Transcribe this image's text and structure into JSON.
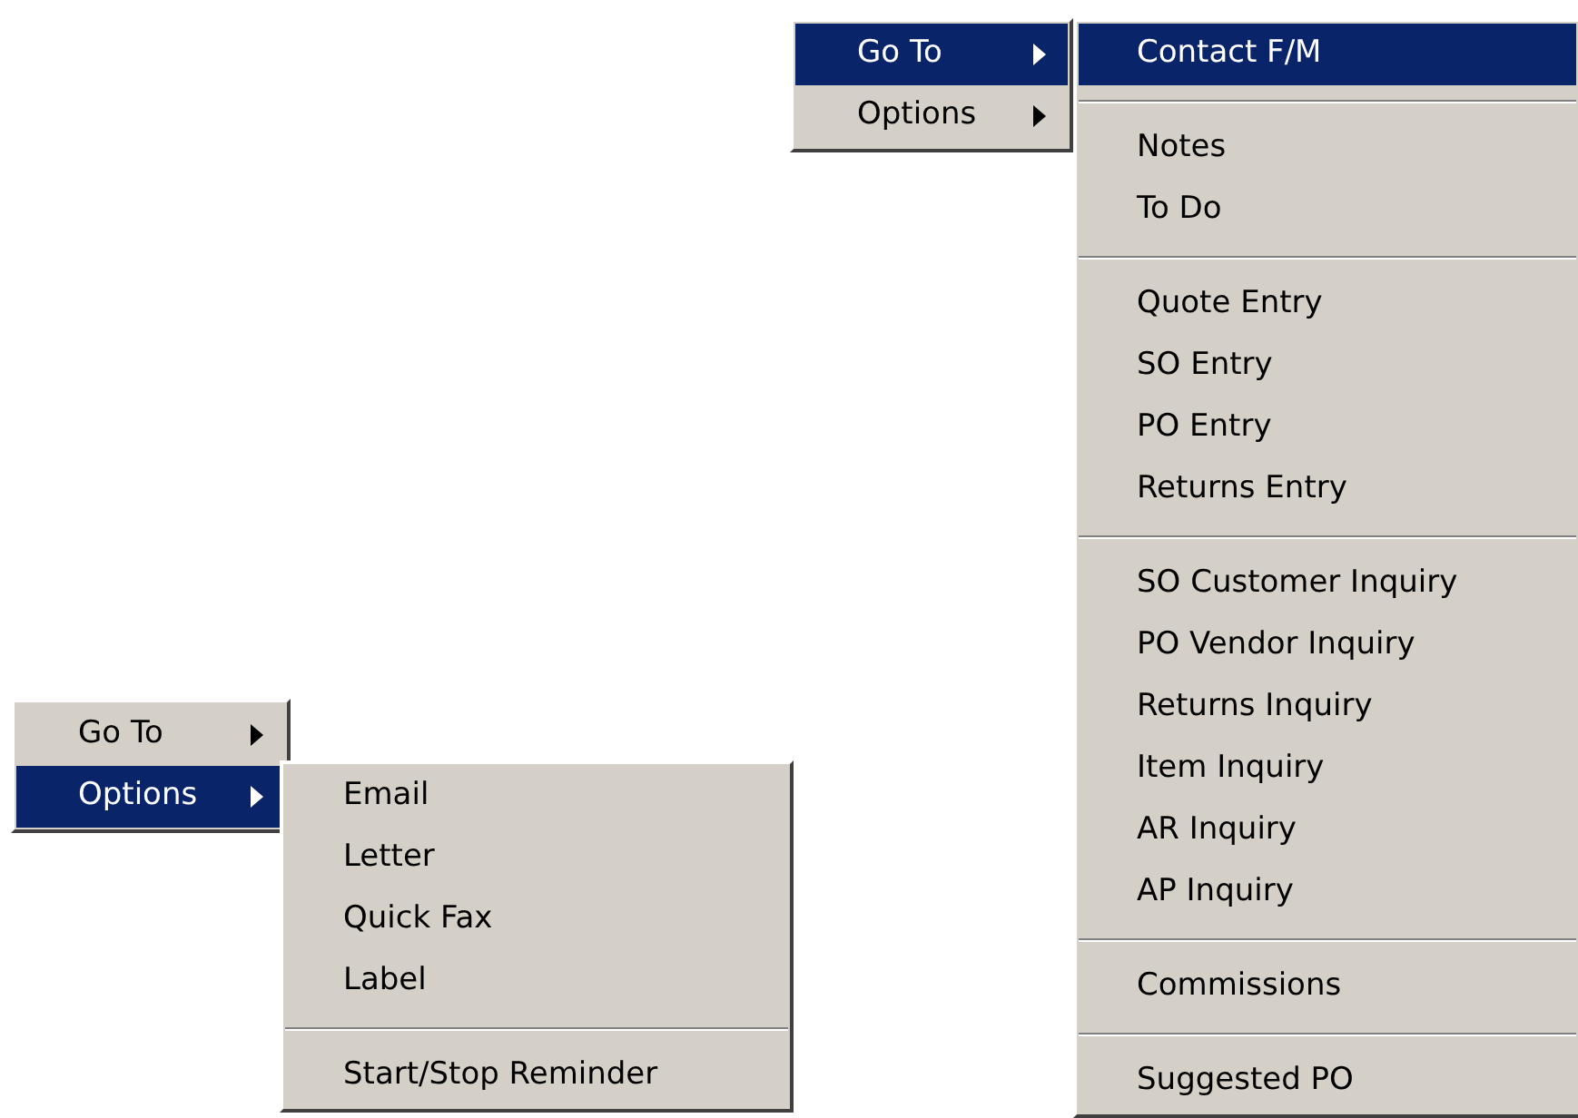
{
  "menus": [
    {
      "items": [
        {
          "label": "Go To",
          "selected": false,
          "has_submenu": true
        },
        {
          "label": "Options",
          "selected": true,
          "has_submenu": true
        }
      ],
      "submenu": {
        "groups": [
          [
            {
              "label": "Email",
              "selected": false
            },
            {
              "label": "Letter",
              "selected": false
            },
            {
              "label": "Quick Fax",
              "selected": false
            },
            {
              "label": "Label",
              "selected": false
            }
          ],
          [
            {
              "label": "Start/Stop Reminder",
              "selected": false
            }
          ]
        ]
      }
    },
    {
      "items": [
        {
          "label": "Go To",
          "selected": true,
          "has_submenu": true
        },
        {
          "label": "Options",
          "selected": false,
          "has_submenu": true
        }
      ],
      "submenu": {
        "groups": [
          [
            {
              "label": "Contact F/M",
              "selected": true
            }
          ],
          [
            {
              "label": "Notes",
              "selected": false
            },
            {
              "label": "To Do",
              "selected": false
            }
          ],
          [
            {
              "label": "Quote Entry",
              "selected": false
            },
            {
              "label": "SO Entry",
              "selected": false
            },
            {
              "label": "PO Entry",
              "selected": false
            },
            {
              "label": "Returns Entry",
              "selected": false
            }
          ],
          [
            {
              "label": "SO Customer Inquiry",
              "selected": false
            },
            {
              "label": "PO Vendor Inquiry",
              "selected": false
            },
            {
              "label": "Returns Inquiry",
              "selected": false
            },
            {
              "label": "Item Inquiry",
              "selected": false
            },
            {
              "label": "AR Inquiry",
              "selected": false
            },
            {
              "label": "AP Inquiry",
              "selected": false
            }
          ],
          [
            {
              "label": "Commissions",
              "selected": false
            }
          ],
          [
            {
              "label": "Suggested PO",
              "selected": false
            }
          ]
        ]
      }
    }
  ]
}
